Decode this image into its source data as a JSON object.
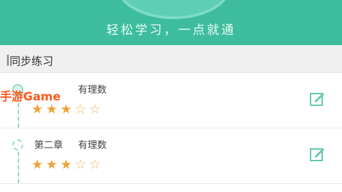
{
  "header": {
    "slogan": "轻松学习，一点就通"
  },
  "section": {
    "title": "同步练习"
  },
  "items": [
    {
      "chapter": "",
      "subject": "有理数",
      "rating": 3,
      "max": 5
    },
    {
      "chapter": "第二章",
      "subject": "有理数",
      "rating": 3,
      "max": 5
    }
  ],
  "watermark": "手游Game",
  "colors": {
    "accent": "#3dbd9e",
    "star": "#f0a23a"
  },
  "icons": {
    "edit": "edit-icon",
    "star": "star-icon"
  }
}
